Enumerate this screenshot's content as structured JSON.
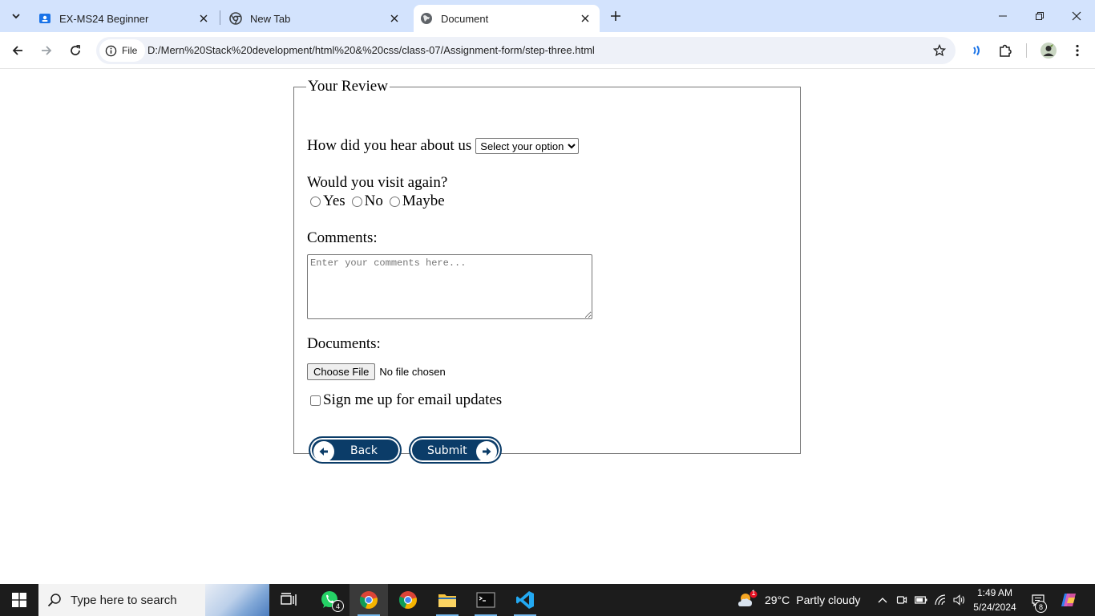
{
  "browser": {
    "tabs": [
      {
        "title": "EX-MS24 Beginner",
        "icon": "classroom-icon",
        "active": false
      },
      {
        "title": "New Tab",
        "icon": "chrome-icon",
        "active": false
      },
      {
        "title": "Document",
        "icon": "globe-icon",
        "active": true
      }
    ],
    "address": {
      "chip_label": "File",
      "url": "D:/Mern%20Stack%20development/html%20&%20css/class-07/Assignment-form/step-three.html"
    }
  },
  "form": {
    "legend": "Your Review",
    "source_question": "How did you hear about us",
    "source_select": {
      "selected": "Select your option"
    },
    "visit_question": "Would you visit again?",
    "visit_options": [
      "Yes",
      "No",
      "Maybe"
    ],
    "comments_label": "Comments:",
    "comments_placeholder": "Enter your comments here...",
    "documents_label": "Documents:",
    "file_button": "Choose File",
    "file_status": "No file chosen",
    "newsletter_label": "Sign me up for email updates",
    "back_button": "Back",
    "submit_button": "Submit",
    "button_color": "#0b3c68"
  },
  "taskbar": {
    "search_placeholder": "Type here to search",
    "whatsapp_badge": "4",
    "weather": {
      "temp": "29°C",
      "condition": "Partly cloudy",
      "alert_count": "1"
    },
    "clock": {
      "time": "1:49 AM",
      "date": "5/24/2024"
    },
    "notifications_count": "8"
  }
}
